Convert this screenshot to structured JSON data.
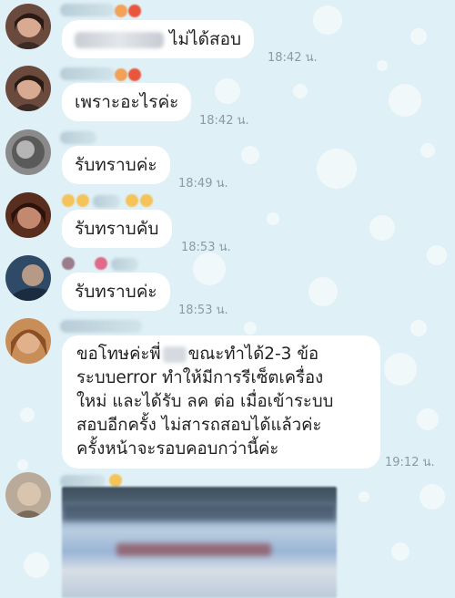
{
  "messages": [
    {
      "text_suffix": "ไม่ได้สอบ",
      "time": "18:42 น."
    },
    {
      "text": "เพราะอะไรค่ะ",
      "time": "18:42 น."
    },
    {
      "text": "รับทราบค่ะ",
      "time": "18:49 น."
    },
    {
      "text": "รับทราบคับ",
      "time": "18:53 น."
    },
    {
      "text": "รับทราบค่ะ",
      "time": "18:53 น."
    },
    {
      "lines": [
        {
          "before": "ขอโทษค่ะพี่",
          "after": "ขณะทำได้2-3 ข้อ"
        },
        "ระบบerror ทำให้มีการรีเซ็ตเครื่อง",
        "ใหม่ และได้รับ ลค ต่อ เมื่อเข้าระบบ",
        "สอบอีกครั้ง ไม่สารถสอบได้แล้วค่ะ",
        "ครั้งหน้าจะรอบคอบกว่านี้ค่ะ"
      ],
      "time": "19:12 น."
    }
  ],
  "colors": {
    "background": "#dff0f6",
    "bubble": "#ffffff",
    "time": "#8c9aa3"
  }
}
